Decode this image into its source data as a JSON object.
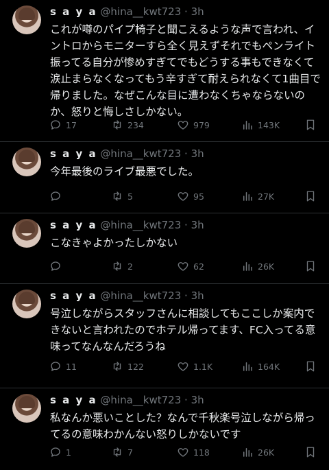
{
  "tweets": [
    {
      "name": "s a y a",
      "handle": "@hina__kwt723",
      "dot": "·",
      "time": "3h",
      "text": "これが噂のパイプ椅子と聞こえるような声で言われ、イントロからモニターすら全く見えずそれでもペンライト振ってる自分が惨めすぎてでもどうする事もできなくて涙止まらなくなってもう辛すぎて耐えられなくて1曲目で帰りました。なぜこんな目に遭わなくちゃならないのか、怒りと悔しさしかない。",
      "replies": "17",
      "retweets": "234",
      "likes": "979",
      "views": "143K"
    },
    {
      "name": "s a y a",
      "handle": "@hina__kwt723",
      "dot": "·",
      "time": "3h",
      "text": "今年最後のライブ最悪でした。",
      "replies": "",
      "retweets": "5",
      "likes": "95",
      "views": "27K"
    },
    {
      "name": "s a y a",
      "handle": "@hina__kwt723",
      "dot": "·",
      "time": "3h",
      "text": "こなきゃよかったしかない",
      "replies": "",
      "retweets": "2",
      "likes": "62",
      "views": "26K"
    },
    {
      "name": "s a y a",
      "handle": "@hina__kwt723",
      "dot": "·",
      "time": "3h",
      "text": "号泣しながらスタッフさんに相談してもここしか案内できないと言われたのでホテル帰ってます、FC入ってる意味ってなんなんだろうね",
      "replies": "11",
      "retweets": "122",
      "likes": "1.1K",
      "views": "164K"
    },
    {
      "name": "s a y a",
      "handle": "@hina__kwt723",
      "dot": "·",
      "time": "3h",
      "text": "私なんか悪いことした？なんで千秋楽号泣しながら帰ってるの意味わかんない怒りしかないです",
      "replies": "1",
      "retweets": "7",
      "likes": "118",
      "views": "26K"
    }
  ],
  "icons": {
    "reply": "reply-icon",
    "retweet": "retweet-icon",
    "like": "heart-icon",
    "views": "views-icon",
    "bookmark": "bookmark-icon"
  },
  "colors": {
    "background": "#000000",
    "text": "#e7e9ea",
    "muted": "#71767b",
    "divider": "#2f3336"
  }
}
